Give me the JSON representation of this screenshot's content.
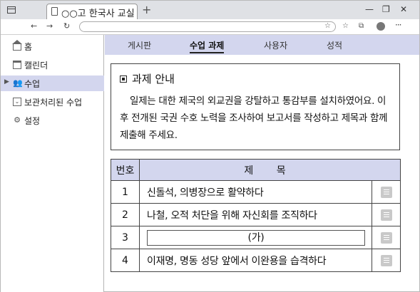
{
  "browser": {
    "tab_title": "○○고 한국사 교실",
    "new_tab": "+",
    "controls": {
      "minimize": "—",
      "restore": "❐",
      "close": "✕"
    },
    "nav": {
      "back": "←",
      "forward": "→",
      "reload": "↻"
    }
  },
  "sidebar": {
    "items": [
      {
        "label": "홈",
        "icon": "home-icon"
      },
      {
        "label": "캘린더",
        "icon": "calendar-icon"
      },
      {
        "label": "수업",
        "icon": "users-icon",
        "active": true
      },
      {
        "label": "보관처리된 수업",
        "icon": "archive-icon"
      },
      {
        "label": "설정",
        "icon": "gear-icon"
      }
    ]
  },
  "topmenu": {
    "items": [
      "게시판",
      "수업 과제",
      "사용자",
      "성적"
    ],
    "active": "수업 과제"
  },
  "notice": {
    "heading": "과제 안내",
    "body": "일제는 대한 제국의 외교권을 강탈하고 통감부를 설치하였어요. 이후 전개된 국권 수호 노력을 조사하여 보고서를 작성하고 제목과 함께 제출해 주세요."
  },
  "table": {
    "headers": {
      "num": "번호",
      "title": "제 목"
    },
    "rows": [
      {
        "num": "1",
        "title": "신돌석, 의병장으로 활약하다"
      },
      {
        "num": "2",
        "title": "나철, 오적 처단을 위해 자신회를 조직하다"
      },
      {
        "num": "3",
        "title": "(가)"
      },
      {
        "num": "4",
        "title": "이재명, 명동 성당 앞에서 이완용을 습격하다"
      }
    ]
  },
  "colors": {
    "accent": "#d3d6ee",
    "border": "#444444"
  }
}
